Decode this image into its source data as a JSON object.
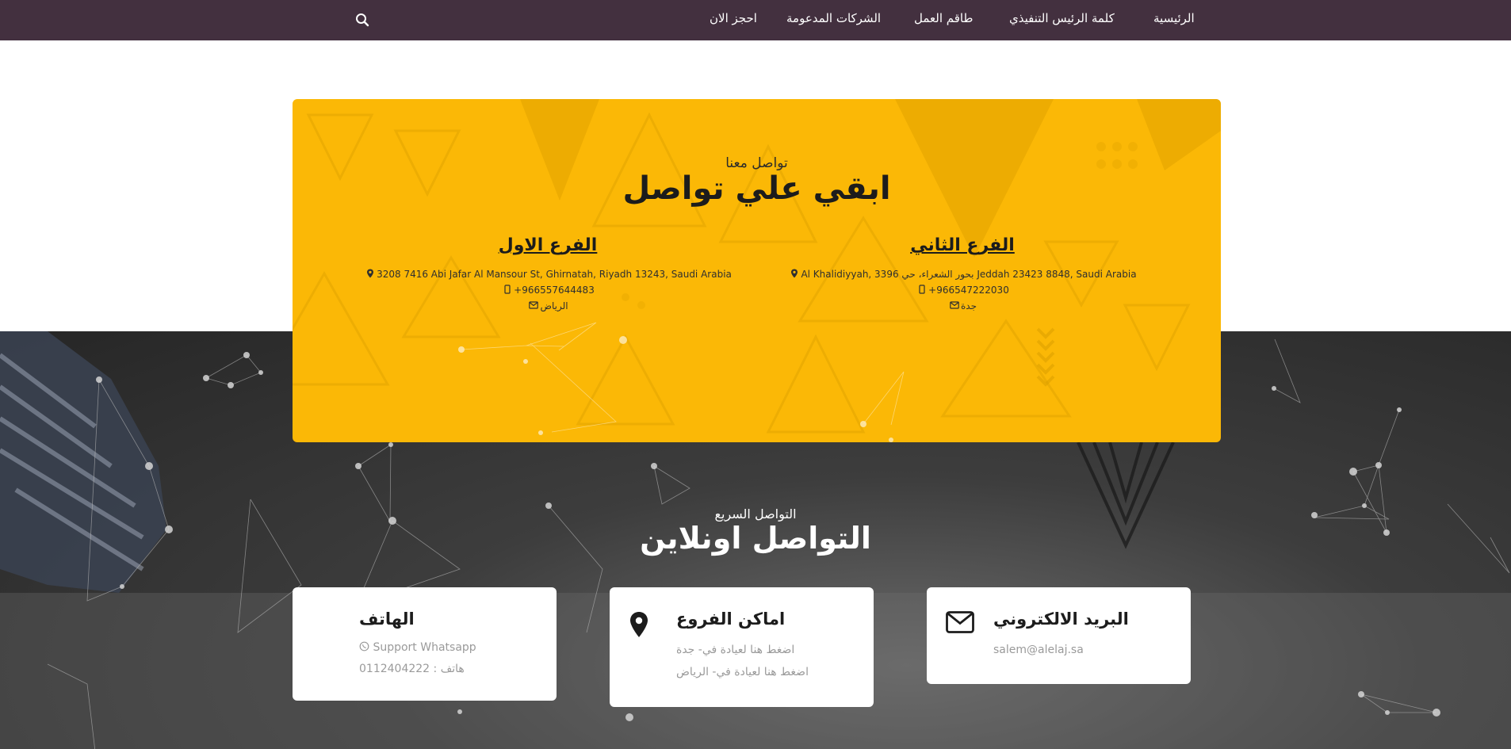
{
  "nav": {
    "items": [
      {
        "label": "الرئيسية"
      },
      {
        "label": "كلمة الرئيس التنفيذي"
      },
      {
        "label": "طاقم العمل"
      },
      {
        "label": "الشركات المدعومة"
      },
      {
        "label": "احجز الان"
      }
    ],
    "search_icon": "search-icon"
  },
  "contact": {
    "subtitle": "تواصل معنا",
    "title": "ابقي علي تواصل",
    "branches": [
      {
        "title": "الفرع الثاني",
        "address": "Al Khalidiyyah, 3396 بحور الشعراء، حي Jeddah 23423 8848, Saudi Arabia",
        "phone": "+966547222030",
        "city": "جدة"
      },
      {
        "title": "الفرع الاول",
        "address": "3208 7416 Abi Jafar Al Mansour St, Ghirnatah, Riyadh 13243, Saudi Arabia",
        "phone": "+966557644483",
        "city": "الرياض"
      }
    ]
  },
  "quick": {
    "subtitle": "التواصل السريع",
    "title": "التواصل اونلاين",
    "cards": {
      "email": {
        "title": "البريد الالكتروني",
        "line1": "salem@alelaj.sa",
        "icon": "envelope-icon"
      },
      "branches": {
        "title": "اماكن الفروع",
        "line1": "اضغط هنا لعيادة في- جدة",
        "line2": "اضغط هنا لعيادة في- الرياض",
        "icon": "map-marker-icon"
      },
      "phone": {
        "title": "الهاتف",
        "line1": "Support Whatsapp",
        "line2": "هاتف : 0112404222"
      }
    }
  },
  "colors": {
    "nav_bg": "#43303f",
    "accent_yellow": "#fbb806",
    "dark_bg": "#2e2e2e"
  }
}
